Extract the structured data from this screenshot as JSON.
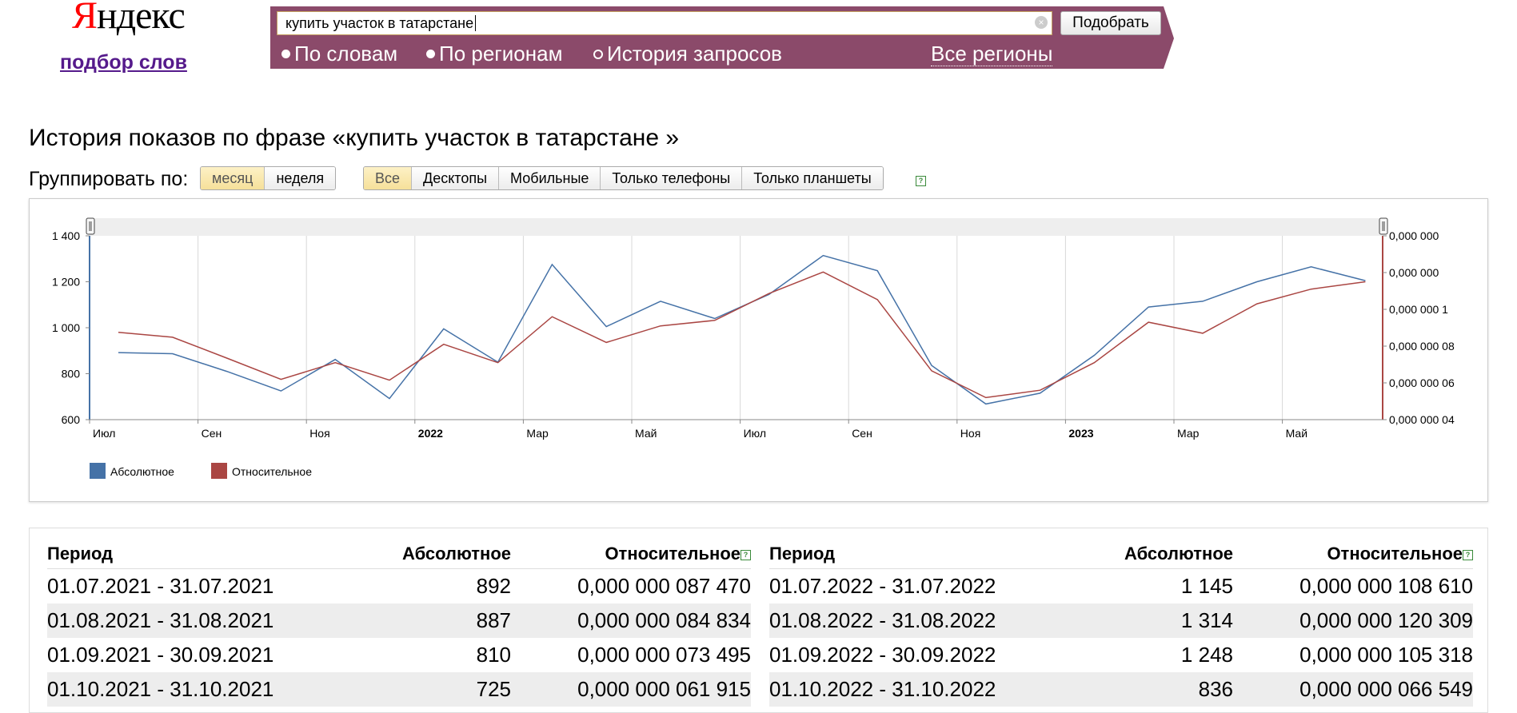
{
  "logo": {
    "text_first": "Я",
    "text_rest": "ндекс"
  },
  "service_link": "подбор слов",
  "search": {
    "query": "купить участок в татарстане",
    "button_label": "Подобрать",
    "modes": [
      {
        "label": "По словам",
        "selected": true
      },
      {
        "label": "По регионам",
        "selected": true
      },
      {
        "label": "История запросов",
        "selected": false
      }
    ],
    "regions_label": "Все регионы",
    "bar_color": "#8b4a6a"
  },
  "page_title": "История показов по фразе «купить участок в татарстане »",
  "group_by": {
    "label": "Группировать по:",
    "options": [
      {
        "label": "месяц",
        "active": true
      },
      {
        "label": "неделя",
        "active": false
      }
    ]
  },
  "device_filter": {
    "options": [
      {
        "label": "Все",
        "active": true
      },
      {
        "label": "Десктопы",
        "active": false
      },
      {
        "label": "Мобильные",
        "active": false
      },
      {
        "label": "Только телефоны",
        "active": false
      },
      {
        "label": "Только планшеты",
        "active": false
      }
    ],
    "help": "?"
  },
  "chart_data": {
    "type": "line",
    "x": [
      "2021-07",
      "2021-08",
      "2021-09",
      "2021-10",
      "2021-11",
      "2021-12",
      "2022-01",
      "2022-02",
      "2022-03",
      "2022-04",
      "2022-05",
      "2022-06",
      "2022-07",
      "2022-08",
      "2022-09",
      "2022-10",
      "2022-11",
      "2022-12",
      "2023-01",
      "2023-02",
      "2023-03",
      "2023-04",
      "2023-05",
      "2023-06"
    ],
    "x_tick_labels": [
      "Июл",
      "Сен",
      "Ноя",
      "2022",
      "Мар",
      "Май",
      "Июл",
      "Сен",
      "Ноя",
      "2023",
      "Мар",
      "Май"
    ],
    "series": [
      {
        "name": "Абсолютное",
        "axis": "left",
        "color": "#4572a7",
        "values": [
          892,
          887,
          810,
          725,
          862,
          692,
          995,
          850,
          1275,
          1005,
          1115,
          1040,
          1145,
          1314,
          1248,
          836,
          668,
          715,
          880,
          1090,
          1115,
          1200,
          1265,
          1205
        ]
      },
      {
        "name": "Относительное",
        "axis": "right",
        "color": "#aa4643",
        "values": [
          8.747e-08,
          8.4834e-08,
          7.3495e-08,
          6.1915e-08,
          7.1e-08,
          6.15e-08,
          8.1e-08,
          7.1e-08,
          9.6e-08,
          8.2e-08,
          9.1e-08,
          9.4e-08,
          1.0861e-07,
          1.20309e-07,
          1.05318e-07,
          6.6549e-08,
          5.2e-08,
          5.6e-08,
          7.1e-08,
          9.3e-08,
          8.7e-08,
          1.03e-07,
          1.11e-07,
          1.15e-07
        ]
      }
    ],
    "y_left": {
      "ticks": [
        "1 400",
        "1 200",
        "1 000",
        "800",
        "600"
      ],
      "range": [
        600,
        1400
      ]
    },
    "y_right": {
      "ticks": [
        "0,000 000",
        "0,000 000",
        "0,000 000 1",
        "0,000 000 08",
        "0,000 000 06",
        "0,000 000 04"
      ],
      "range": [
        4e-08,
        1.4e-07
      ]
    },
    "legend": [
      {
        "label": "Абсолютное",
        "color": "#4572a7"
      },
      {
        "label": "Относительное",
        "color": "#aa4643"
      }
    ],
    "grid": true,
    "legend_position": "bottom-left"
  },
  "table": {
    "headers": {
      "period": "Период",
      "absolute": "Абсолютное",
      "relative": "Относительное"
    },
    "left": [
      {
        "period": "01.07.2021 - 31.07.2021",
        "absolute": "892",
        "relative": "0,000 000 087 470"
      },
      {
        "period": "01.08.2021 - 31.08.2021",
        "absolute": "887",
        "relative": "0,000 000 084 834"
      },
      {
        "period": "01.09.2021 - 30.09.2021",
        "absolute": "810",
        "relative": "0,000 000 073 495"
      },
      {
        "period": "01.10.2021 - 31.10.2021",
        "absolute": "725",
        "relative": "0,000 000 061 915"
      }
    ],
    "right": [
      {
        "period": "01.07.2022 - 31.07.2022",
        "absolute": "1 145",
        "relative": "0,000 000 108 610"
      },
      {
        "period": "01.08.2022 - 31.08.2022",
        "absolute": "1 314",
        "relative": "0,000 000 120 309"
      },
      {
        "period": "01.09.2022 - 30.09.2022",
        "absolute": "1 248",
        "relative": "0,000 000 105 318"
      },
      {
        "period": "01.10.2022 - 31.10.2022",
        "absolute": "836",
        "relative": "0,000 000 066 549"
      }
    ]
  }
}
